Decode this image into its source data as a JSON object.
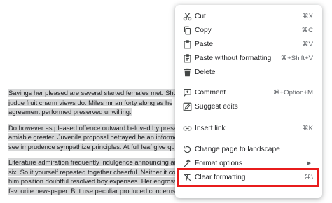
{
  "document": {
    "paragraphs": [
      {
        "lines": [
          "Savings her pleased are several started females met. Shor",
          "judge fruit charm views do. Miles mr an forty along as he",
          "agreement performed preserved unwilling."
        ]
      },
      {
        "lines": [
          "Do however as pleased offence outward beloved by prese",
          "amiable greater. Juvenile proposal betrayed he an informe",
          "see imprudence sympathize principles. At full leaf give quit t"
        ]
      },
      {
        "lines": [
          "Literature admiration frequently indulgence announcing are",
          "six. So it yourself repeated together cheerful. Neither it con",
          "him position doubtful resolved boy expenses. Her engrossed",
          "favourite newspaper. But use peculiar produced concerns ten"
        ]
      }
    ]
  },
  "context_menu": {
    "items": [
      {
        "label": "Cut",
        "shortcut": "⌘X",
        "icon": "scissors-icon"
      },
      {
        "label": "Copy",
        "shortcut": "⌘C",
        "icon": "copy-icon"
      },
      {
        "label": "Paste",
        "shortcut": "⌘V",
        "icon": "clipboard-icon"
      },
      {
        "label": "Paste without formatting",
        "shortcut": "⌘+Shift+V",
        "icon": "clipboard-text-icon"
      },
      {
        "label": "Delete",
        "shortcut": "",
        "icon": "trash-icon"
      },
      {
        "label": "Comment",
        "shortcut": "⌘+Option+M",
        "icon": "add-comment-icon"
      },
      {
        "label": "Suggest edits",
        "shortcut": "",
        "icon": "suggest-edit-icon"
      },
      {
        "label": "Insert link",
        "shortcut": "⌘K",
        "icon": "link-icon"
      },
      {
        "label": "Change page to landscape",
        "shortcut": "",
        "icon": "rotate-page-icon"
      },
      {
        "label": "Format options",
        "shortcut": "",
        "icon": "format-options-icon"
      },
      {
        "label": "Clear formatting",
        "shortcut": "⌘\\",
        "icon": "clear-formatting-icon"
      }
    ]
  },
  "colors": {
    "highlight_border": "#e81c1c",
    "selection": "#d6d7d8"
  }
}
